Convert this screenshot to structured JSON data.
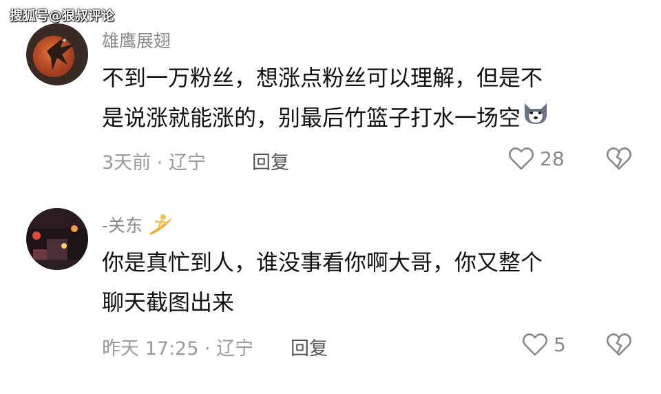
{
  "watermark": "搜狐号@狠叔评论",
  "comments": [
    {
      "username": "雄鹰展翅",
      "text_line1": "不到一万粉丝，想涨点粉丝可以理解，但是不",
      "text_line2": "是说涨就能涨的，别最后竹篮子打水一场空",
      "time": "3天前",
      "sep": "·",
      "location": "辽宁",
      "reply_label": "回复",
      "likes": "28",
      "avatar_icon": "eagle-moon-avatar",
      "inline_emoji": "husky-dog-emoji"
    },
    {
      "username": "-关东",
      "username_emoji": "surfer-emoji",
      "text_line1": "你是真忙到人，谁没事看你啊大哥，你又整个",
      "text_line2": "聊天截图出来",
      "time": "昨天 17:25",
      "sep": "·",
      "location": "辽宁",
      "reply_label": "回复",
      "likes": "5",
      "avatar_icon": "night-street-avatar"
    }
  ],
  "colors": {
    "meta": "#9a9a9a",
    "username": "#8a8a8a",
    "text": "#111111"
  }
}
